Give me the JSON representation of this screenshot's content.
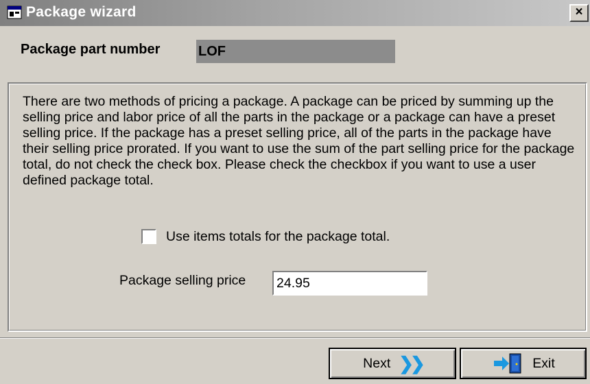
{
  "window": {
    "title": "Package wizard",
    "close_label": "×"
  },
  "header": {
    "part_number_label": "Package part number",
    "part_number_value": "LOF"
  },
  "main": {
    "description": "There are two methods of pricing a package.  A package can be priced by summing up the selling price and labor price of all the parts in the package or a package can have a preset selling price.  If the package has a preset selling price, all of the parts in the package have their selling price prorated.  If you want to use the sum of the part selling price for the package total, do not check the check box.  Please check the checkbox if you want to use a user defined package total.",
    "checkbox_label": "Use items totals for the package total.",
    "checkbox_checked": false,
    "price_label": "Package selling price",
    "price_value": "24.95"
  },
  "buttons": {
    "next_label": "Next",
    "next_icon": "double-chevron-right-icon",
    "exit_label": "Exit",
    "exit_icon": "exit-door-icon"
  },
  "colors": {
    "title_gradient_start": "#808080",
    "title_gradient_end": "#c8c8c8",
    "dialog_background": "#d4d0c8",
    "part_number_background": "#8c8c8c",
    "next_arrow": "#1a98e0"
  }
}
